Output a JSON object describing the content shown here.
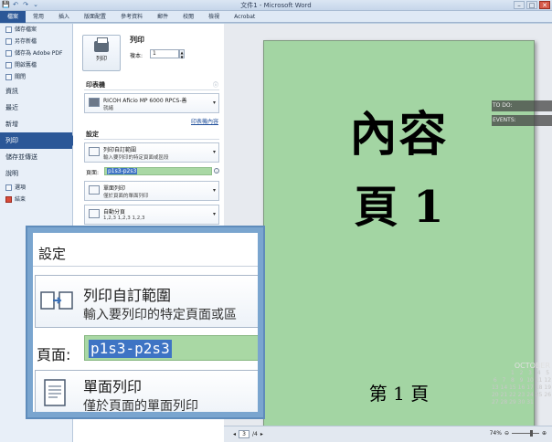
{
  "window": {
    "title": "文件1 - Microsoft Word",
    "quick_access": [
      "💾",
      "↶",
      "↷",
      "⌄"
    ],
    "controls": [
      "–",
      "□",
      "✕"
    ]
  },
  "ribbon": {
    "tabs": [
      "檔案",
      "常用",
      "插入",
      "版面配置",
      "參考資料",
      "郵件",
      "校閱",
      "檢視",
      "Acrobat"
    ]
  },
  "nav": {
    "top_items": [
      "儲存檔案",
      "另存新檔",
      "儲存為 Adobe PDF",
      "開啟舊檔",
      "關閉"
    ],
    "sections": [
      "資訊",
      "最近",
      "新增",
      "列印",
      "儲存並傳送",
      "說明"
    ],
    "bottom_items": [
      "選項",
      "結束"
    ],
    "active": "列印"
  },
  "print": {
    "heading": "列印",
    "button_label": "列印",
    "copies_label": "複本:",
    "copies_value": "1",
    "printer_section": "印表機",
    "printer_name": "RICOH Aficio MP 6000 RPCS-善",
    "printer_status": "就緒",
    "printer_props_link": "印表機內容",
    "settings_section": "設定",
    "range_title": "列印自訂範圍",
    "range_sub": "輸入要列印的特定頁面或區段",
    "pages_label": "頁面:",
    "pages_value": "p1s3-p2s3",
    "sides_title": "單面列印",
    "sides_sub": "僅於頁面的單面列印",
    "collate_title": "自動分頁",
    "collate_sub": "1,2,3   1,2,3   1,2,3"
  },
  "preview": {
    "line1": "內容",
    "line2": "頁 1",
    "footer": "第 1 頁",
    "page_current": "3",
    "page_total": "/4",
    "zoom": "74%"
  },
  "desktop": {
    "todo": "TO DO:",
    "events": "EVENTS:",
    "month": "OCTOBER",
    "days": [
      "",
      "",
      "1",
      "2",
      "3",
      "4",
      "5",
      "6",
      "7",
      "8",
      "9",
      "10",
      "11",
      "12",
      "13",
      "14",
      "15",
      "16",
      "17",
      "18",
      "19",
      "20",
      "21",
      "22",
      "23",
      "24",
      "25",
      "26",
      "27",
      "28",
      "29",
      "30",
      "31",
      "",
      ""
    ]
  },
  "inset": {
    "title": "設定",
    "range_title": "列印自訂範圍",
    "range_sub": "輸入要列印的特定頁面或區",
    "pages_label": "頁面:",
    "pages_value": "p1s3-p2s3",
    "sides_title": "單面列印",
    "sides_sub": "僅於頁面的單面列印"
  }
}
